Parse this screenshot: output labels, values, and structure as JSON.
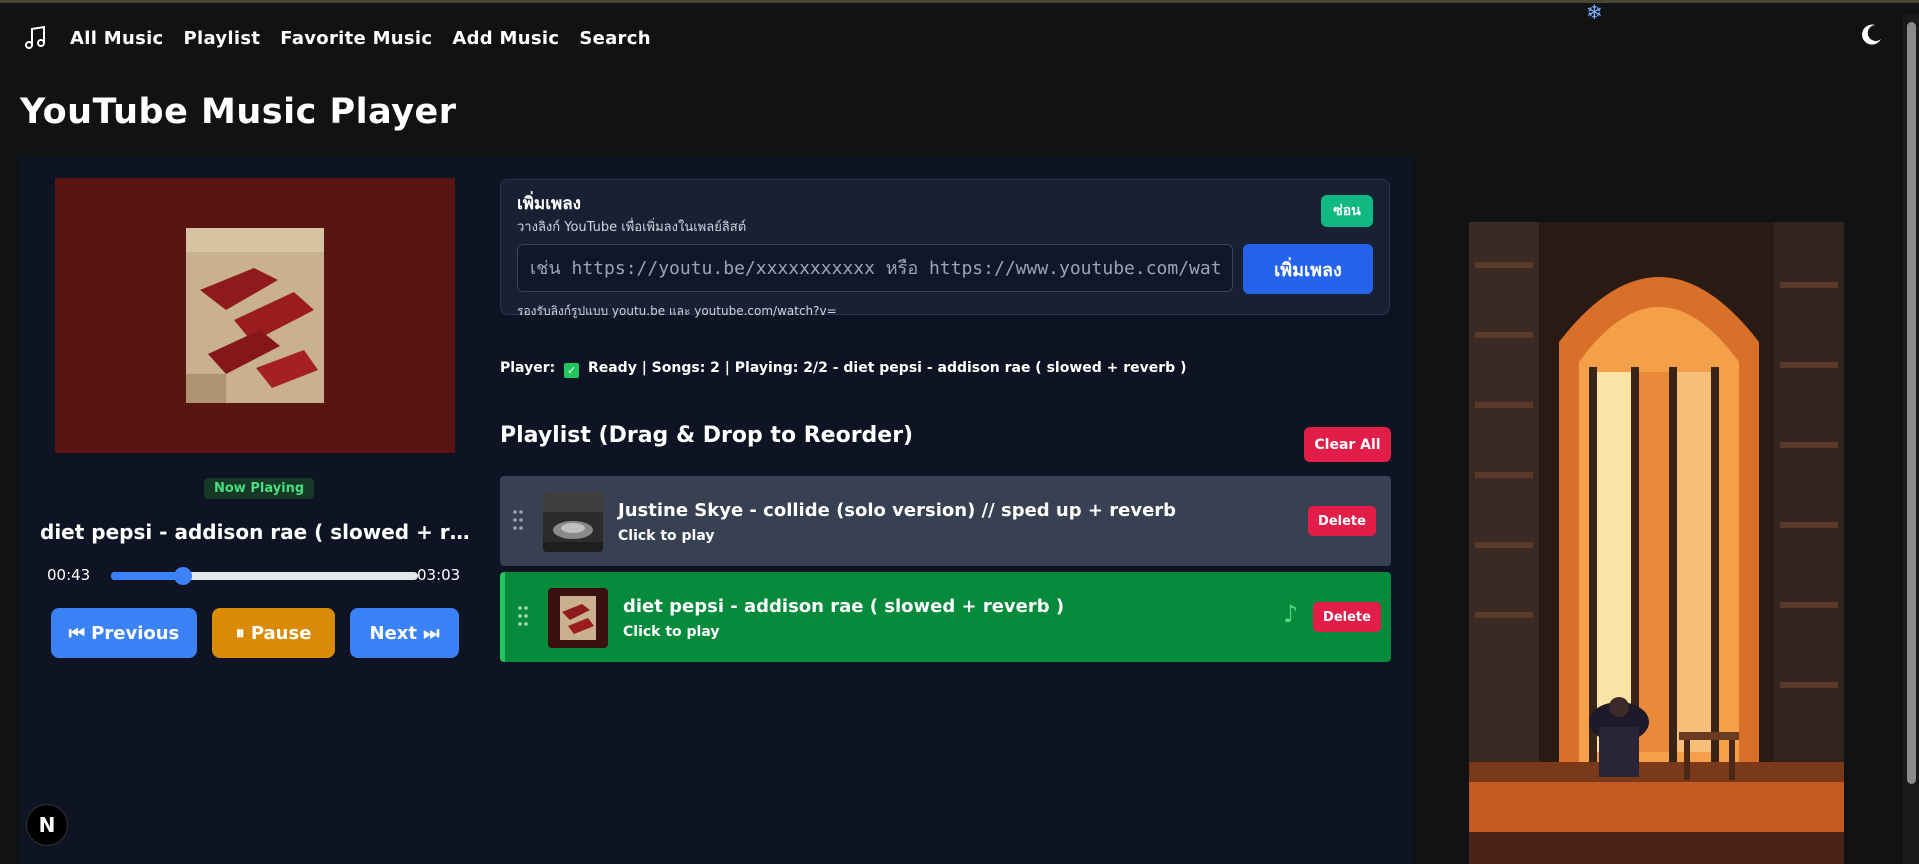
{
  "nav": {
    "items": [
      "All Music",
      "Playlist",
      "Favorite Music",
      "Add Music",
      "Search"
    ]
  },
  "page": {
    "title": "YouTube Music Player"
  },
  "player": {
    "now_playing_badge": "Now Playing",
    "track_title": "diet pepsi - addison rae ( slowed + reverb )",
    "current_time": "00:43",
    "total_time": "03:03",
    "progress_fraction": 0.235,
    "prev_label": "⏮ Previous",
    "pause_label": "⏸ Pause",
    "next_label": "Next ⏭"
  },
  "add_song": {
    "title": "เพิ่มเพลง",
    "subtitle": "วางลิงก์ YouTube เพื่อเพิ่มลงในเพลย์ลิสต์",
    "hide_label": "ซ่อน",
    "input_placeholder": "เช่น https://youtu.be/xxxxxxxxxxx หรือ https://www.youtube.com/watch?v=xxxxxxxxxxx",
    "input_value": "",
    "add_label": "เพิ่มเพลง",
    "hint": "รองรับลิงก์รูปแบบ youtu.be และ youtube.com/watch?v="
  },
  "status": {
    "prefix": "Player:",
    "text": "Ready | Songs: 2 | Playing: 2/2 - diet pepsi - addison rae ( slowed + reverb )"
  },
  "playlist": {
    "title": "Playlist (Drag & Drop to Reorder)",
    "clear_label": "Clear All",
    "items": [
      {
        "title": "Justine Skye - collide (solo version) // sped up + reverb",
        "subtitle": "Click to play",
        "delete_label": "Delete",
        "playing": false
      },
      {
        "title": "diet pepsi - addison rae ( slowed + reverb )",
        "subtitle": "Click to play",
        "delete_label": "Delete",
        "playing": true
      }
    ]
  },
  "widget": {
    "badge_letter": "N"
  },
  "colors": {
    "background": "#111214",
    "panel": "#0e1424",
    "accent_blue": "#3b82f6",
    "pause_orange": "#d98b06",
    "danger": "#e11d48",
    "playing_green": "#068a3b",
    "hide_green": "#10b981"
  },
  "icons": [
    "music-note-icon",
    "moon-icon",
    "snowflake-icon",
    "drag-handle-icon",
    "playing-note-icon"
  ]
}
